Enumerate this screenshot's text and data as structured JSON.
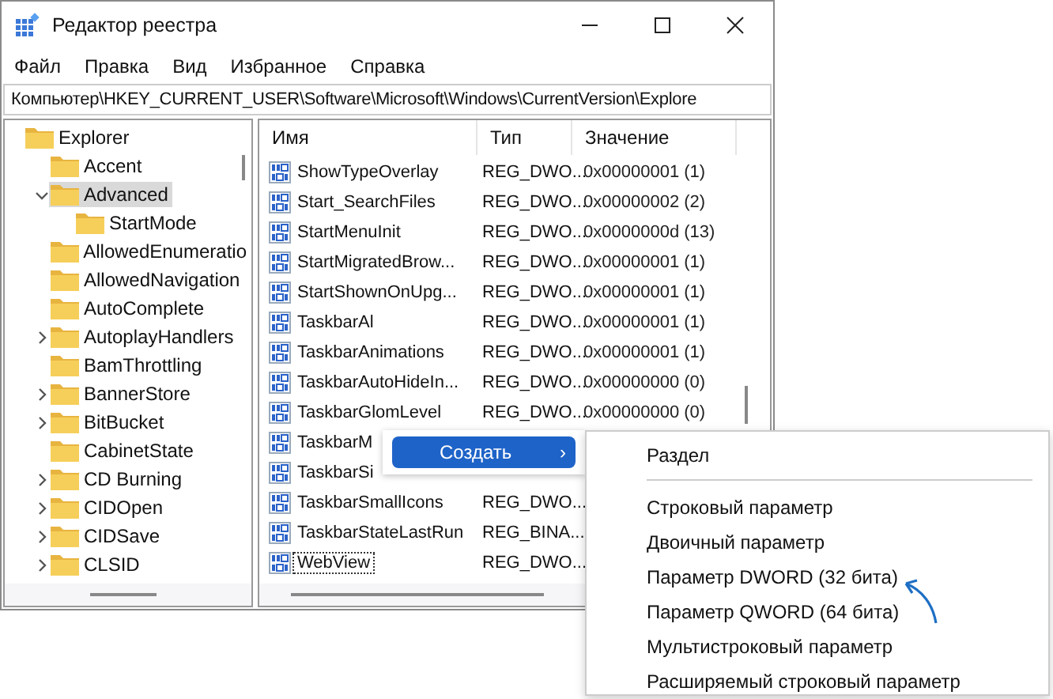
{
  "window": {
    "title": "Редактор реестра"
  },
  "menu": [
    "Файл",
    "Правка",
    "Вид",
    "Избранное",
    "Справка"
  ],
  "address": "Компьютер\\HKEY_CURRENT_USER\\Software\\Microsoft\\Windows\\CurrentVersion\\Explore",
  "tree": [
    {
      "label": "Explorer",
      "selected": false,
      "children": [
        {
          "label": "Accent",
          "selected": false
        },
        {
          "label": "Advanced",
          "selected": true,
          "expanded": true,
          "children": [
            {
              "label": "StartMode",
              "selected": false
            }
          ]
        },
        {
          "label": "AllowedEnumeratio",
          "selected": false
        },
        {
          "label": "AllowedNavigation",
          "selected": false
        },
        {
          "label": "AutoComplete",
          "selected": false
        },
        {
          "label": "AutoplayHandlers",
          "selected": false,
          "expanded": false
        },
        {
          "label": "BamThrottling",
          "selected": false
        },
        {
          "label": "BannerStore",
          "selected": false,
          "expanded": false
        },
        {
          "label": "BitBucket",
          "selected": false,
          "expanded": false
        },
        {
          "label": "CabinetState",
          "selected": false
        },
        {
          "label": "CD Burning",
          "selected": false,
          "expanded": false
        },
        {
          "label": "CIDOpen",
          "selected": false,
          "expanded": false
        },
        {
          "label": "CIDSave",
          "selected": false,
          "expanded": false
        },
        {
          "label": "CLSID",
          "selected": false,
          "expanded": false
        }
      ]
    }
  ],
  "table": {
    "columns": [
      "Имя",
      "Тип",
      "Значение"
    ],
    "rows": [
      {
        "name": "ShowTypeOverlay",
        "type": "REG_DWO...",
        "value": "0x00000001 (1)",
        "focused": false
      },
      {
        "name": "Start_SearchFiles",
        "type": "REG_DWO...",
        "value": "0x00000002 (2)",
        "focused": false
      },
      {
        "name": "StartMenuInit",
        "type": "REG_DWO...",
        "value": "0x0000000d (13)",
        "focused": false
      },
      {
        "name": "StartMigratedBrow...",
        "type": "REG_DWO...",
        "value": "0x00000001 (1)",
        "focused": false
      },
      {
        "name": "StartShownOnUpg...",
        "type": "REG_DWO...",
        "value": "0x00000001 (1)",
        "focused": false
      },
      {
        "name": "TaskbarAl",
        "type": "REG_DWO...",
        "value": "0x00000001 (1)",
        "focused": false
      },
      {
        "name": "TaskbarAnimations",
        "type": "REG_DWO...",
        "value": "0x00000001 (1)",
        "focused": false
      },
      {
        "name": "TaskbarAutoHideIn...",
        "type": "REG_DWO...",
        "value": "0x00000000 (0)",
        "focused": false
      },
      {
        "name": "TaskbarGlomLevel",
        "type": "REG_DWO...",
        "value": "0x00000000 (0)",
        "focused": false
      },
      {
        "name": "TaskbarM",
        "focused": false
      },
      {
        "name": "TaskbarSi",
        "focused": false
      },
      {
        "name": "TaskbarSmallIcons",
        "type": "REG_DWO...",
        "focused": false
      },
      {
        "name": "TaskbarStateLastRun",
        "type": "REG_BINA...",
        "focused": false
      },
      {
        "name": "WebView",
        "type": "REG_DWO...",
        "focused": true
      }
    ]
  },
  "context_menu": {
    "item": "Создать",
    "arrow": "›"
  },
  "submenu": [
    {
      "kind": "item",
      "label": "Раздел"
    },
    {
      "kind": "separator"
    },
    {
      "kind": "item",
      "label": "Строковый параметр"
    },
    {
      "kind": "item",
      "label": "Двоичный параметр"
    },
    {
      "kind": "item",
      "label": "Параметр DWORD (32 бита)"
    },
    {
      "kind": "item",
      "label": "Параметр QWORD (64 бита)"
    },
    {
      "kind": "item",
      "label": "Мультистроковый параметр"
    },
    {
      "kind": "item",
      "label": "Расширяемый строковый параметр"
    }
  ]
}
